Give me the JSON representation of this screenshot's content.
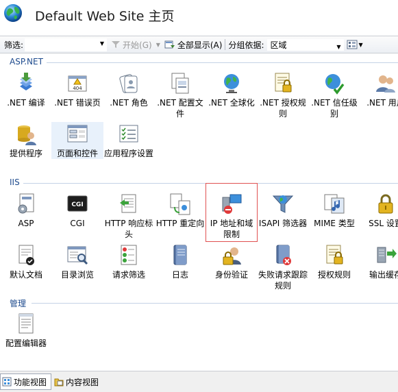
{
  "header": {
    "title": "Default Web Site 主页"
  },
  "toolbar": {
    "filter_label": "筛选:",
    "start_label": "开始(G)",
    "show_all_label": "全部显示(A)",
    "group_by_label": "分组依据:",
    "group_by_value": "区域"
  },
  "groups": {
    "aspnet": {
      "title": "ASP.NET"
    },
    "iis": {
      "title": "IIS"
    },
    "manage": {
      "title": "管理"
    }
  },
  "aspnet_items": [
    {
      "label": ".NET 编译",
      "icon": "compile-icon"
    },
    {
      "label": ".NET 错误页",
      "icon": "error-page-icon"
    },
    {
      "label": ".NET 角色",
      "icon": "roles-icon"
    },
    {
      "label": ".NET 配置文件",
      "icon": "profile-icon"
    },
    {
      "label": ".NET 全球化",
      "icon": "globalization-icon"
    },
    {
      "label": ".NET 授权规则",
      "icon": "authorization-icon"
    },
    {
      "label": ".NET 信任级别",
      "icon": "trust-level-icon"
    },
    {
      "label": ".NET 用户",
      "icon": "users-icon"
    },
    {
      "label": "提供程序",
      "icon": "providers-icon"
    },
    {
      "label": "页面和控件",
      "icon": "pages-controls-icon"
    },
    {
      "label": "应用程序设置",
      "icon": "app-settings-icon"
    }
  ],
  "iis_items": [
    {
      "label": "ASP",
      "icon": "asp-icon"
    },
    {
      "label": "CGI",
      "icon": "cgi-icon"
    },
    {
      "label": "HTTP 响应标头",
      "icon": "http-headers-icon"
    },
    {
      "label": "HTTP 重定向",
      "icon": "http-redirect-icon"
    },
    {
      "label": "IP 地址和域限制",
      "icon": "ip-restrictions-icon"
    },
    {
      "label": "ISAPI 筛选器",
      "icon": "isapi-filters-icon"
    },
    {
      "label": "MIME 类型",
      "icon": "mime-types-icon"
    },
    {
      "label": "SSL 设置",
      "icon": "ssl-icon"
    },
    {
      "label": "默认文档",
      "icon": "default-document-icon"
    },
    {
      "label": "目录浏览",
      "icon": "directory-browsing-icon"
    },
    {
      "label": "请求筛选",
      "icon": "request-filtering-icon"
    },
    {
      "label": "日志",
      "icon": "logging-icon"
    },
    {
      "label": "身份验证",
      "icon": "authentication-icon"
    },
    {
      "label": "失败请求跟踪规则",
      "icon": "failed-request-icon"
    },
    {
      "label": "授权规则",
      "icon": "authorization-rules-icon"
    },
    {
      "label": "输出缓存",
      "icon": "output-cache-icon"
    }
  ],
  "manage_items": [
    {
      "label": "配置编辑器",
      "icon": "config-editor-icon"
    }
  ],
  "bottom": {
    "features_view": "功能视图",
    "content_view": "内容视图"
  }
}
